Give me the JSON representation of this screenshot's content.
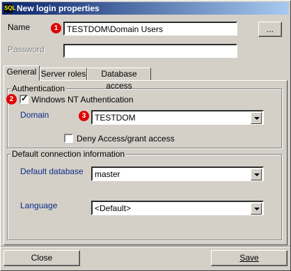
{
  "window": {
    "title": "New login properties",
    "icon": "app-icon"
  },
  "name_field": {
    "label": "Name",
    "value": "TESTDOM\\Domain Users",
    "browse_label": "..."
  },
  "password_field": {
    "label": "Password",
    "value": ""
  },
  "tabs": [
    {
      "label": "General"
    },
    {
      "label": "Server roles"
    },
    {
      "label": "Database access"
    }
  ],
  "authentication": {
    "group_label": "Authentication",
    "windows_nt": {
      "label": "Windows NT Authentication",
      "checked": true
    },
    "domain": {
      "label": "Domain",
      "value": "TESTDOM"
    },
    "deny_access": {
      "label": "Deny Access/grant access",
      "checked": false
    }
  },
  "defaults": {
    "group_label": "Default connection information",
    "database": {
      "label": "Default database",
      "value": "master"
    },
    "language": {
      "label": "Language",
      "value": "<Default>"
    }
  },
  "buttons": {
    "close": "Close",
    "save": "Save"
  },
  "markers": [
    "1",
    "2",
    "3"
  ],
  "colors": {
    "title_bar": "#0a246a",
    "marker": "#e00000",
    "label_blue": "#0b2b8a"
  }
}
